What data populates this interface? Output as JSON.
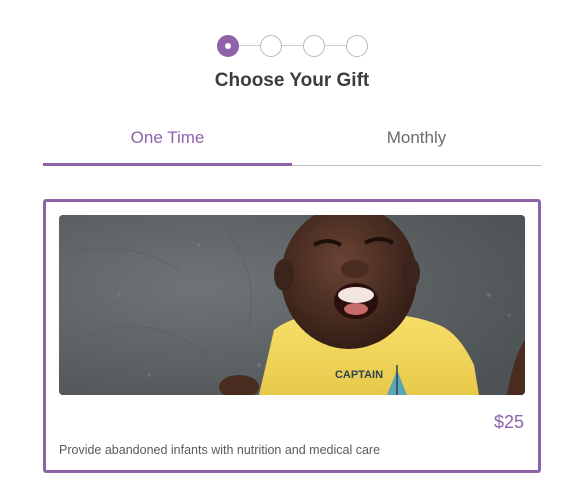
{
  "progress": {
    "total_steps": 4,
    "current_step": 1
  },
  "title": "Choose Your Gift",
  "tabs": [
    {
      "label": "One Time",
      "selected": true
    },
    {
      "label": "Monthly",
      "selected": false
    }
  ],
  "gift": {
    "amount": "$25",
    "description": "Provide abandoned infants with nutrition and medical care",
    "shirt_text": "CAPTAIN"
  },
  "colors": {
    "accent": "#8e63a9",
    "text": "#3d3d3d",
    "muted": "#6b6b6b"
  }
}
